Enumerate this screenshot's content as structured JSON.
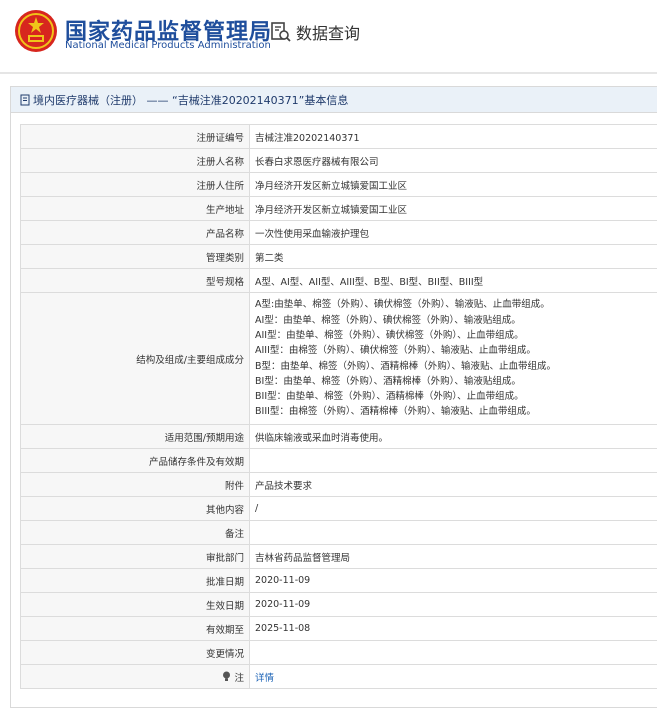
{
  "header": {
    "org_name_cn": "国家药品监督管理局",
    "org_name_en": "National Medical Products Administration",
    "query_label": "数据查询"
  },
  "breadcrumb": {
    "text": "境内医疗器械（注册） —— “吉械注准20202140371”基本信息"
  },
  "fields": [
    {
      "label": "注册证编号",
      "value": "吉械注准20202140371"
    },
    {
      "label": "注册人名称",
      "value": "长春白求恩医疗器械有限公司"
    },
    {
      "label": "注册人住所",
      "value": "净月经济开发区新立城镇爱国工业区"
    },
    {
      "label": "生产地址",
      "value": "净月经济开发区新立城镇爱国工业区"
    },
    {
      "label": "产品名称",
      "value": "一次性使用采血输液护理包"
    },
    {
      "label": "管理类别",
      "value": "第二类"
    },
    {
      "label": "型号规格",
      "value": "A型、AI型、AII型、AIII型、B型、BI型、BII型、BIII型"
    }
  ],
  "structure": {
    "label": "结构及组成/主要组成成分",
    "lines": [
      "A型:由垫单、棉签（外购）、碘伏棉签（外购）、输液贴、止血带组成。",
      "AI型：由垫单、棉签（外购）、碘伏棉签（外购）、输液贴组成。",
      "AII型：由垫单、棉签（外购）、碘伏棉签（外购）、止血带组成。",
      "AIII型：由棉签（外购）、碘伏棉签（外购）、输液贴、止血带组成。",
      "B型：由垫单、棉签（外购）、酒精棉棒（外购）、输液贴、止血带组成。",
      "BI型：由垫单、棉签（外购）、酒精棉棒（外购）、输液贴组成。",
      "BII型：由垫单、棉签（外购）、酒精棉棒（外购）、止血带组成。",
      "BIII型：由棉签（外购）、酒精棉棒（外购）、输液贴、止血带组成。"
    ]
  },
  "fields2": [
    {
      "label": "适用范围/预期用途",
      "value": "供临床输液或采血时消毒使用。"
    },
    {
      "label": "产品储存条件及有效期",
      "value": ""
    },
    {
      "label": "附件",
      "value": "产品技术要求"
    },
    {
      "label": "其他内容",
      "value": "/"
    },
    {
      "label": "备注",
      "value": ""
    },
    {
      "label": "审批部门",
      "value": "吉林省药品监督管理局"
    },
    {
      "label": "批准日期",
      "value": "2020-11-09"
    },
    {
      "label": "生效日期",
      "value": "2020-11-09"
    },
    {
      "label": "有效期至",
      "value": "2025-11-08"
    },
    {
      "label": "变更情况",
      "value": ""
    }
  ],
  "note": {
    "label": "注",
    "link": "详情"
  },
  "colors": {
    "brand_blue": "#1f4e9c",
    "emblem_red": "#d7261e",
    "emblem_gold": "#f0c419",
    "bar_bg": "#eaf1f8",
    "link": "#1a62b6"
  }
}
